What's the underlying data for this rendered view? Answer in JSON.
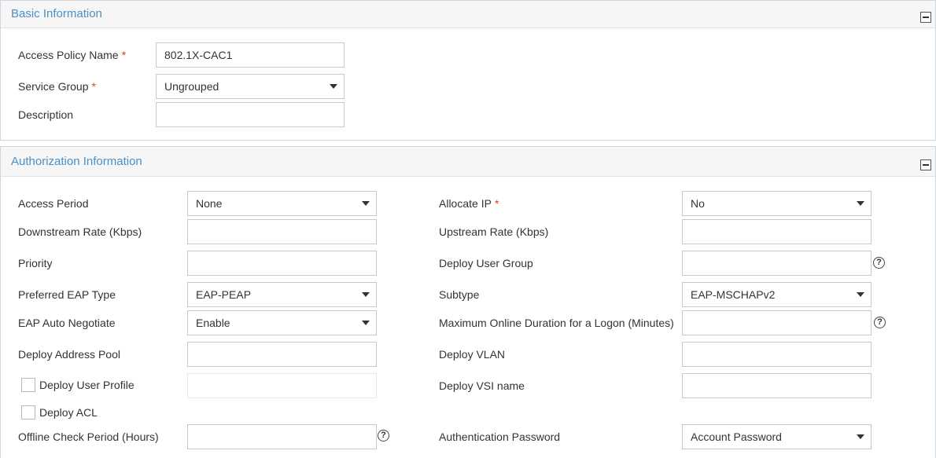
{
  "basic": {
    "title": "Basic Information",
    "access_policy_name_label": "Access Policy Name",
    "access_policy_name_value": "802.1X-CAC1",
    "service_group_label": "Service Group",
    "service_group_value": "Ungrouped",
    "description_label": "Description",
    "description_value": "",
    "required_mark": "*"
  },
  "auth": {
    "title": "Authorization Information",
    "access_period_label": "Access Period",
    "access_period_value": "None",
    "allocate_ip_label": "Allocate IP",
    "allocate_ip_value": "No",
    "downstream_rate_label": "Downstream Rate (Kbps)",
    "upstream_rate_label": "Upstream Rate (Kbps)",
    "priority_label": "Priority",
    "deploy_user_group_label": "Deploy User Group",
    "preferred_eap_label": "Preferred EAP Type",
    "preferred_eap_value": "EAP-PEAP",
    "subtype_label": "Subtype",
    "subtype_value": "EAP-MSCHAPv2",
    "eap_auto_negotiate_label": "EAP Auto Negotiate",
    "eap_auto_negotiate_value": "Enable",
    "max_online_duration_label": "Maximum Online Duration for a Logon (Minutes)",
    "deploy_address_pool_label": "Deploy Address Pool",
    "deploy_vlan_label": "Deploy VLAN",
    "deploy_user_profile_label": "Deploy User Profile",
    "deploy_vsi_name_label": "Deploy VSI name",
    "deploy_acl_label": "Deploy ACL",
    "offline_check_label": "Offline Check Period (Hours)",
    "auth_password_label": "Authentication Password",
    "auth_password_value": "Account Password",
    "help_glyph": "?"
  }
}
